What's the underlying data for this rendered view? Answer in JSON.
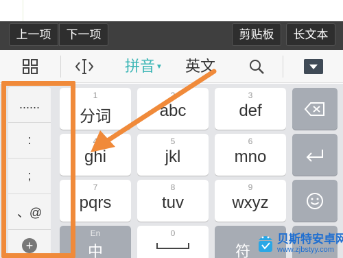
{
  "toolbar": {
    "prev_label": "上一项",
    "next_label": "下一项",
    "clipboard_label": "剪贴板",
    "long_text_label": "长文本"
  },
  "ime_bar": {
    "pinyin_label": "拼音",
    "english_label": "英文"
  },
  "symbols": [
    "......",
    ":",
    ";",
    "、@"
  ],
  "keys": [
    {
      "num": "1",
      "label": "分词"
    },
    {
      "num": "2",
      "label": "abc"
    },
    {
      "num": "3",
      "label": "def"
    },
    {
      "num": "4",
      "label": "ghi"
    },
    {
      "num": "5",
      "label": "jkl"
    },
    {
      "num": "6",
      "label": "mno"
    },
    {
      "num": "7",
      "label": "pqrs"
    },
    {
      "num": "8",
      "label": "tuv"
    },
    {
      "num": "9",
      "label": "wxyz"
    }
  ],
  "bottom_row": {
    "lang_sub": "En",
    "lang_main": "中",
    "space_num": "0",
    "symbol_label": "符"
  },
  "watermark": {
    "title": "贝斯特安卓网",
    "url": "www.zjbstyy.com"
  },
  "colors": {
    "highlight": "#f08a3a",
    "pinyin_accent": "#3ab5b5"
  }
}
